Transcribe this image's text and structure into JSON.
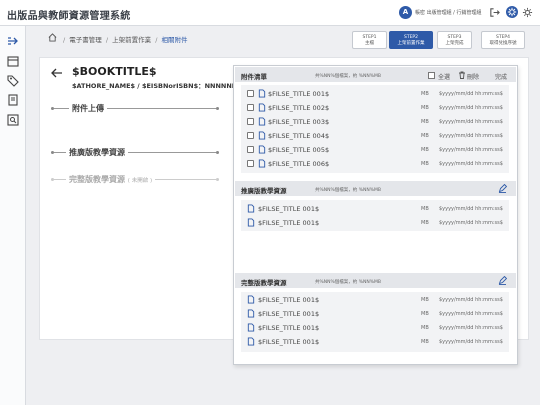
{
  "app": {
    "title": "出版品與教師資源管理系統"
  },
  "user": {
    "avatar_letter": "A",
    "text": "帳密 出版管理組 / 行銷管理組"
  },
  "topbar_icons": [
    "logout-icon",
    "gear-icon",
    "settings-icon"
  ],
  "sidebar": {
    "items": [
      "expand-icon",
      "box-icon",
      "tag-icon",
      "book-icon",
      "search-list-icon"
    ]
  },
  "breadcrumb": {
    "items": [
      "電子書管理",
      "上架前置作業",
      "相關附件"
    ]
  },
  "steps": [
    {
      "label": "STEP1",
      "sub": "主檔"
    },
    {
      "label": "STEP2",
      "sub": "上架前置作業"
    },
    {
      "label": "STEP3",
      "sub": "上架完成"
    },
    {
      "label": "STEP4",
      "sub": "取得兌換序號"
    }
  ],
  "book": {
    "title": "$BOOKTITLE$",
    "meta": "$ATHORE_NAME$ / $EISBNorISBN$：NNNNNNNNNNN"
  },
  "sections": {
    "attachments": "附件上傳",
    "promo": "推廣版教學資源",
    "full": "完整版教學資源",
    "full_note": "( 未開啟 )"
  },
  "panel": {
    "attach": {
      "title": "附件清單",
      "count": "共%NN%個檔案，約 %NN%MB",
      "select_all": "全選",
      "delete": "刪除",
      "done": "完成",
      "files": [
        {
          "name": "$FILSE_TITLE 001$",
          "size": "MB",
          "date": "$yyyy/mm/dd hh:mm:ss$"
        },
        {
          "name": "$FILSE_TITLE 002$",
          "size": "MB",
          "date": "$yyyy/mm/dd hh:mm:ss$"
        },
        {
          "name": "$FILSE_TITLE 003$",
          "size": "MB",
          "date": "$yyyy/mm/dd hh:mm:ss$"
        },
        {
          "name": "$FILSE_TITLE 004$",
          "size": "MB",
          "date": "$yyyy/mm/dd hh:mm:ss$"
        },
        {
          "name": "$FILSE_TITLE 005$",
          "size": "MB",
          "date": "$yyyy/mm/dd hh:mm:ss$"
        },
        {
          "name": "$FILSE_TITLE 006$",
          "size": "MB",
          "date": "$yyyy/mm/dd hh:mm:ss$"
        }
      ]
    },
    "promo": {
      "title": "推廣版教學資源",
      "count": "共%NN%個檔案，約 %NN%MB",
      "files": [
        {
          "name": "$FILSE_TITLE 001$",
          "size": "MB",
          "date": "$yyyy/mm/dd hh:mm:ss$"
        },
        {
          "name": "$FILSE_TITLE 001$",
          "size": "MB",
          "date": "$yyyy/mm/dd hh:mm:ss$"
        }
      ]
    },
    "full": {
      "title": "完整版教學資源",
      "count": "共%NN%個檔案，約 %NN%MB",
      "files": [
        {
          "name": "$FILSE_TITLE 001$",
          "size": "MB",
          "date": "$yyyy/mm/dd hh:mm:ss$"
        },
        {
          "name": "$FILSE_TITLE 001$",
          "size": "MB",
          "date": "$yyyy/mm/dd hh:mm:ss$"
        },
        {
          "name": "$FILSE_TITLE 001$",
          "size": "MB",
          "date": "$yyyy/mm/dd hh:mm:ss$"
        },
        {
          "name": "$FILSE_TITLE 001$",
          "size": "MB",
          "date": "$yyyy/mm/dd hh:mm:ss$"
        }
      ]
    }
  },
  "colors": {
    "primary": "#2e5aa8",
    "header_bg": "#e4e6ea",
    "list_bg": "#f2f3f5",
    "file_icon": "#2e5aa8"
  }
}
